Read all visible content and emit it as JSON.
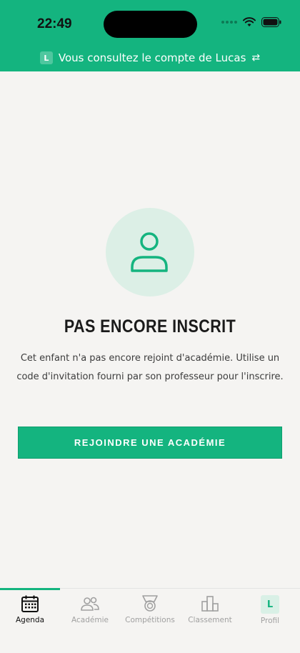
{
  "status_bar": {
    "time": "22:49"
  },
  "banner": {
    "badge": "L",
    "text": "Vous consultez le compte de Lucas",
    "swap_icon": "⇄"
  },
  "empty_state": {
    "icon": "user-icon",
    "title": "PAS ENCORE INSCRIT",
    "description": "Cet enfant n'a pas encore rejoint d'académie. Utilise un code d'invitation fourni par son professeur pour l'inscrire.",
    "button_label": "REJOINDRE UNE ACADÉMIE"
  },
  "tabs": [
    {
      "label": "Agenda",
      "icon": "calendar-icon",
      "active": true
    },
    {
      "label": "Académie",
      "icon": "group-icon",
      "active": false
    },
    {
      "label": "Compétitions",
      "icon": "medal-icon",
      "active": false
    },
    {
      "label": "Classement",
      "icon": "podium-icon",
      "active": false
    },
    {
      "label": "Profil",
      "icon": "profile-badge",
      "badge": "L",
      "active": false
    }
  ],
  "colors": {
    "brand": "#14b47f",
    "avatar_bg": "#dcefe6",
    "background": "#f5f4f2"
  }
}
